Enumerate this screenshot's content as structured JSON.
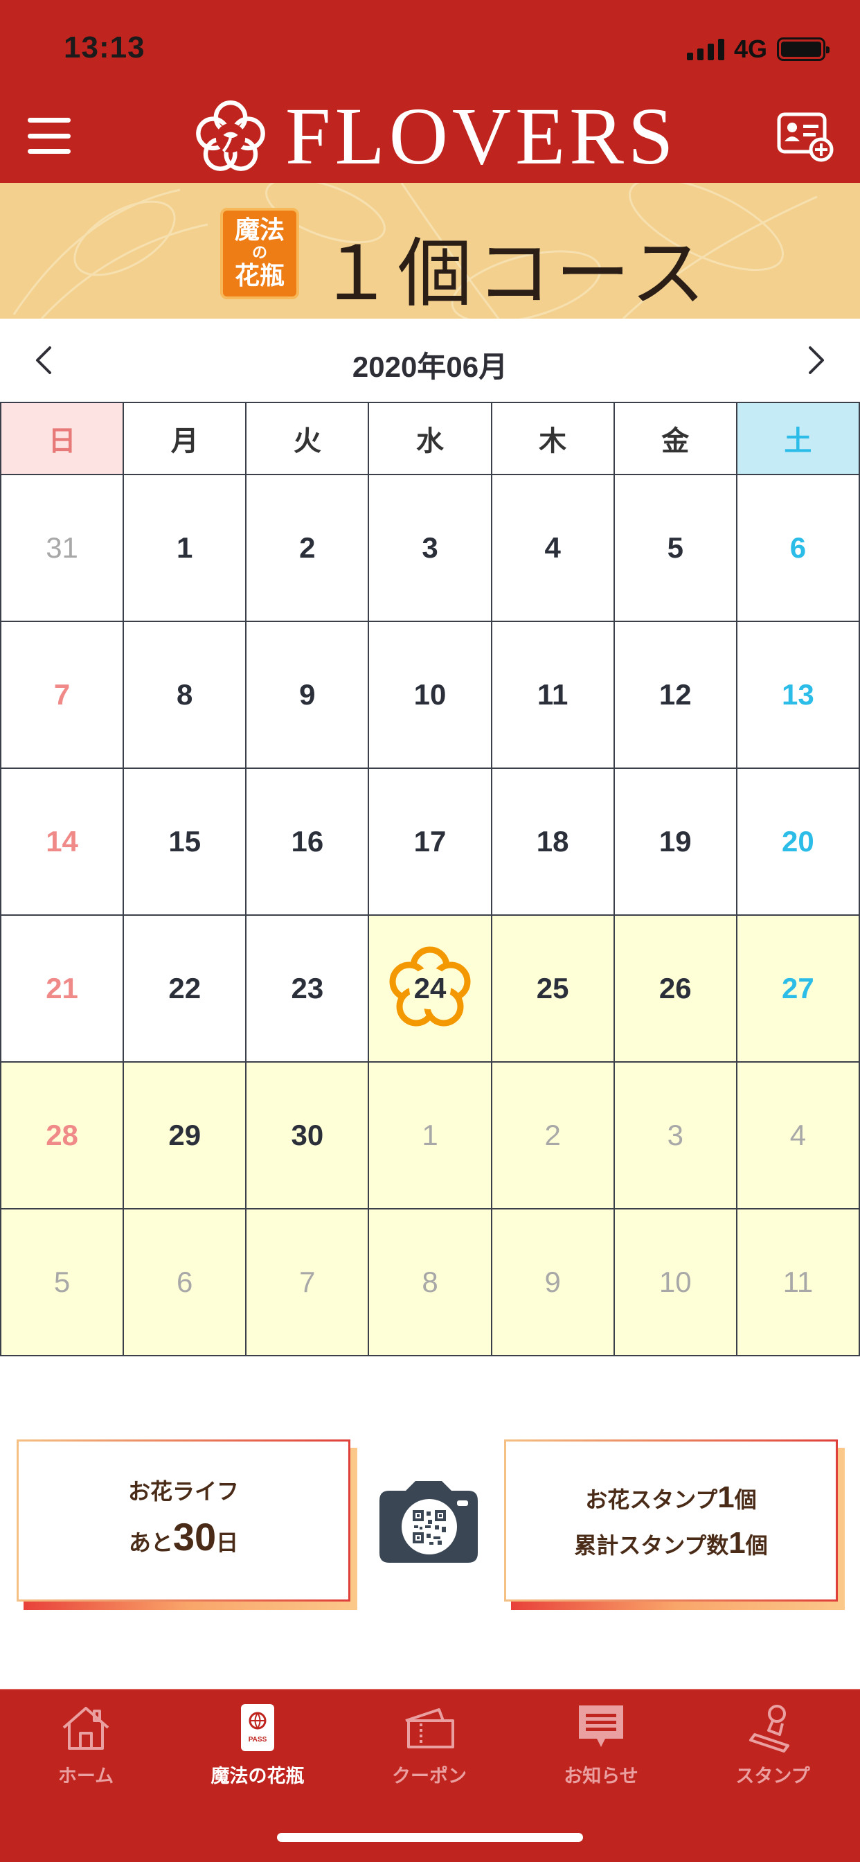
{
  "status_bar": {
    "time": "13:13",
    "network": "4G"
  },
  "header": {
    "brand": "FLOVERS",
    "menu_icon": "hamburger-menu-icon",
    "card_icon": "member-card-add-icon"
  },
  "course": {
    "badge_line1": "魔法",
    "badge_mid": "の",
    "badge_line2": "花瓶",
    "title": "１個コース"
  },
  "calendar": {
    "month": "2020年06月",
    "weekdays": [
      "日",
      "月",
      "火",
      "水",
      "木",
      "金",
      "土"
    ],
    "today": "24",
    "days": [
      [
        "31",
        "1",
        "2",
        "3",
        "4",
        "5",
        "6"
      ],
      [
        "7",
        "8",
        "9",
        "10",
        "11",
        "12",
        "13"
      ],
      [
        "14",
        "15",
        "16",
        "17",
        "18",
        "19",
        "20"
      ],
      [
        "21",
        "22",
        "23",
        "24",
        "25",
        "26",
        "27"
      ],
      [
        "28",
        "29",
        "30",
        "1",
        "2",
        "3",
        "4"
      ],
      [
        "5",
        "6",
        "7",
        "8",
        "9",
        "10",
        "11"
      ]
    ]
  },
  "flower_life": {
    "line1": "お花ライフ",
    "prefix": "あと",
    "days_left": "30",
    "suffix": "日"
  },
  "stamps": {
    "label1": "お花スタンプ",
    "count1": "1",
    "unit1": "個",
    "label2": "累計スタンプ数",
    "count2": "1",
    "unit2": "個"
  },
  "scan_icon": "qr-camera-icon",
  "colors": {
    "primary": "#c0241f",
    "banner": "#f3d08d",
    "highlight": "#ffffd7",
    "today_flower": "#f39800",
    "sunday_text": "#ef8a88",
    "saturday_text": "#2bbce8"
  },
  "tabs": [
    {
      "label": "ホーム",
      "icon": "home-icon",
      "active": false
    },
    {
      "label": "魔法の花瓶",
      "icon": "pass-icon",
      "active": true
    },
    {
      "label": "クーポン",
      "icon": "coupon-icon",
      "active": false
    },
    {
      "label": "お知らせ",
      "icon": "news-icon",
      "active": false
    },
    {
      "label": "スタンプ",
      "icon": "stamp-icon",
      "active": false
    }
  ]
}
